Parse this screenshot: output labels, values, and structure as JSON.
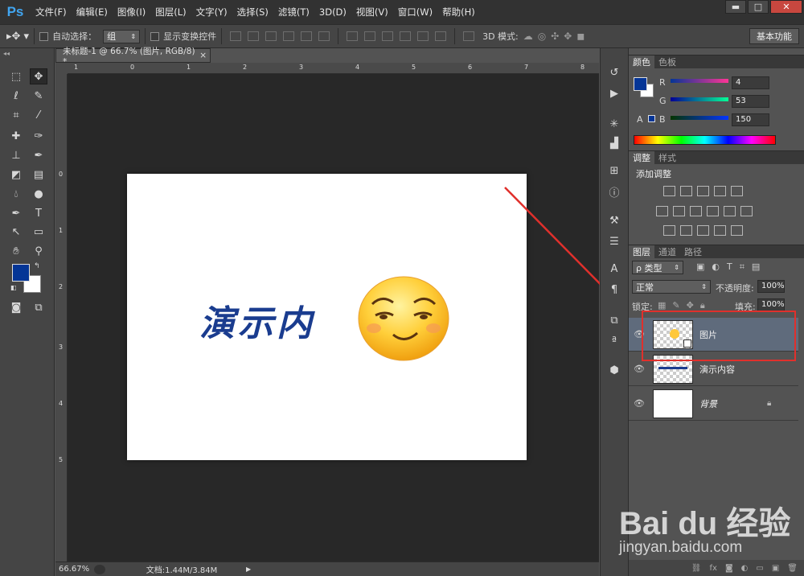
{
  "app": {
    "logo": "Ps",
    "menus": [
      "文件(F)",
      "编辑(E)",
      "图像(I)",
      "图层(L)",
      "文字(Y)",
      "选择(S)",
      "滤镜(T)",
      "3D(D)",
      "视图(V)",
      "窗口(W)",
      "帮助(H)"
    ]
  },
  "window_controls": {
    "minimize": "▬",
    "maximize": "□",
    "close": "✕"
  },
  "options": {
    "auto_select_label": "自动选择：",
    "auto_select_value": "组",
    "show_transform_label": "显示变换控件",
    "mode3d_label": "3D 模式:",
    "workspace": "基本功能"
  },
  "document": {
    "tab_title": "未标题-1 @ 66.7% (图片, RGB/8) *",
    "close": "×",
    "canvas_text": "演示内",
    "ruler_top": [
      "1",
      "0",
      "1",
      "2",
      "3",
      "4",
      "5",
      "6",
      "7",
      "8"
    ],
    "ruler_left": [
      "0",
      "1",
      "2",
      "3",
      "4",
      "5"
    ]
  },
  "status": {
    "zoom": "66.67%",
    "doc_info": "文档:1.44M/3.84M"
  },
  "color_panel": {
    "tabs": [
      "颜色",
      "色板"
    ],
    "r_label": "R",
    "g_label": "G",
    "b_label": "B",
    "r": "4",
    "g": "53",
    "b": "150",
    "fg_color": "#043596"
  },
  "adjust_panel": {
    "tabs": [
      "调整",
      "样式"
    ],
    "title": "添加调整"
  },
  "layers_panel": {
    "tabs": [
      "图层",
      "通道",
      "路径"
    ],
    "kind_label": "ρ 类型",
    "blend_mode": "正常",
    "opacity_label": "不透明度:",
    "opacity": "100%",
    "lock_label": "锁定:",
    "fill_label": "填充:",
    "fill": "100%",
    "layers": [
      {
        "name": "图片",
        "selected": true
      },
      {
        "name": "演示内容",
        "selected": false
      },
      {
        "name": "背景",
        "selected": false
      }
    ]
  },
  "watermark": {
    "brand": "Bai du 经验",
    "url": "jingyan.baidu.com"
  }
}
